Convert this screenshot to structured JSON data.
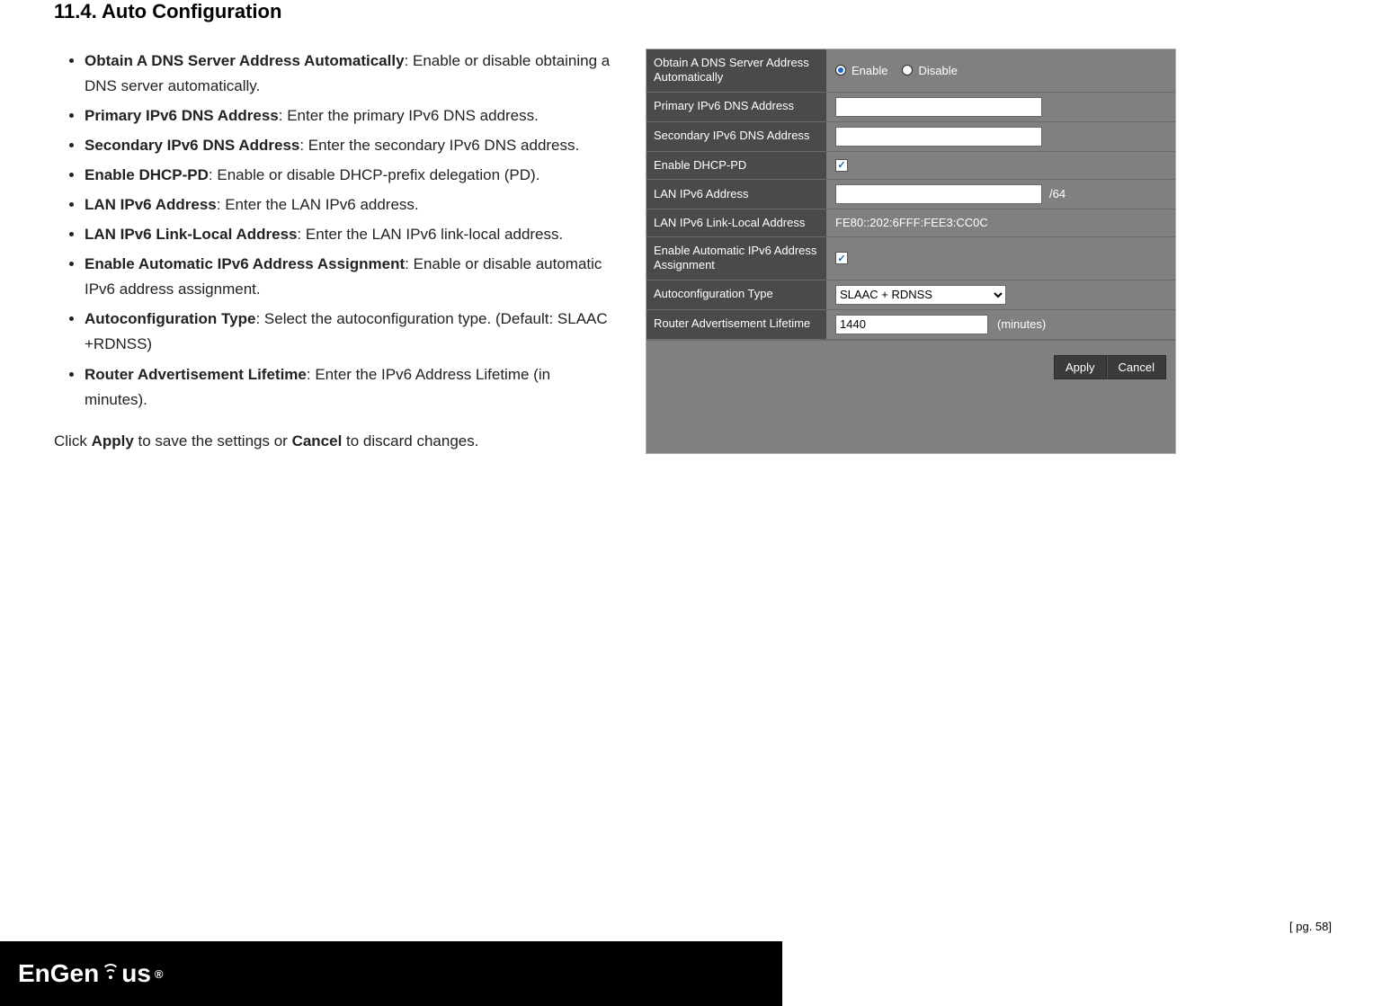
{
  "heading": "11.4.  Auto Configuration",
  "bullets": [
    {
      "term": "Obtain A DNS Server Address Automatically",
      "desc": ": Enable or disable obtaining a DNS server automatically."
    },
    {
      "term": "Primary IPv6 DNS Address",
      "desc": ": Enter the primary IPv6 DNS address."
    },
    {
      "term": "Secondary IPv6 DNS Address",
      "desc": ": Enter the secondary IPv6 DNS address."
    },
    {
      "term": "Enable DHCP-PD",
      "desc": ": Enable or disable DHCP-prefix delegation (PD)."
    },
    {
      "term": "LAN IPv6 Address",
      "desc": ": Enter the LAN IPv6 address."
    },
    {
      "term": "LAN IPv6 Link-Local Address",
      "desc": ": Enter the LAN IPv6 link-local address."
    },
    {
      "term": "Enable Automatic IPv6 Address Assignment",
      "desc": ": Enable or disable automatic IPv6 address assignment."
    },
    {
      "term": "Autoconfiguration Type",
      "desc": ": Select the autoconfiguration type. (Default: SLAAC +RDNSS)"
    },
    {
      "term": "Router Advertisement Lifetime",
      "desc": ": Enter the IPv6 Address Lifetime (in minutes)."
    }
  ],
  "applyLine": {
    "pre": "Click ",
    "apply": "Apply",
    "mid": " to save the settings or ",
    "cancel": "Cancel",
    "post": " to discard changes."
  },
  "panel": {
    "rows": {
      "dnsAuto": {
        "label": "Obtain A DNS Server Address Automatically",
        "opt1": "Enable",
        "opt2": "Disable",
        "selected": "Enable"
      },
      "primaryDns": {
        "label": "Primary IPv6 DNS Address",
        "value": ""
      },
      "secondaryDns": {
        "label": "Secondary IPv6 DNS Address",
        "value": ""
      },
      "dhcpPd": {
        "label": "Enable DHCP-PD",
        "checked": true
      },
      "lanIpv6": {
        "label": "LAN IPv6 Address",
        "value": "",
        "suffix": "/64"
      },
      "linkLocal": {
        "label": "LAN IPv6 Link-Local Address",
        "value": "FE80::202:6FFF:FEE3:CC0C"
      },
      "autoAssign": {
        "label": "Enable Automatic IPv6 Address Assignment",
        "checked": true
      },
      "autoconfType": {
        "label": "Autoconfiguration Type",
        "value": "SLAAC + RDNSS"
      },
      "raLifetime": {
        "label": "Router Advertisement Lifetime",
        "value": "1440",
        "unit": "(minutes)"
      }
    },
    "buttons": {
      "apply": "Apply",
      "cancel": "Cancel"
    }
  },
  "footer": {
    "brandLeft": "EnGen",
    "brandRight": "us",
    "reg": "®",
    "page": "[ pg. 58]"
  }
}
